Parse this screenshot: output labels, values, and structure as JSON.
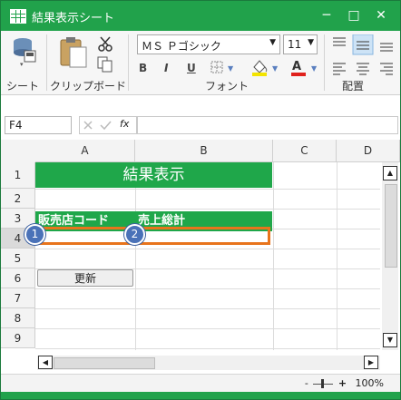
{
  "window": {
    "title": "結果表示シート",
    "minimize": "─",
    "maximize": "□",
    "close": "✕"
  },
  "ribbon": {
    "groups": {
      "sheet": "シート",
      "clipboard": "クリップボード",
      "font": "フォント",
      "align": "配置"
    },
    "font_name": "ＭＳ Ｐゴシック",
    "font_size": "11",
    "bold": "B",
    "italic": "I",
    "underline": "U"
  },
  "formula_bar": {
    "name_box": "F4",
    "fx": "fx",
    "value": ""
  },
  "columns": [
    "A",
    "B",
    "C",
    "D"
  ],
  "rows": [
    "1",
    "2",
    "3",
    "4",
    "5",
    "6",
    "7",
    "8",
    "9"
  ],
  "cells": {
    "title": "結果表示",
    "a3": "販売店コード",
    "b3": "売上総計"
  },
  "markers": [
    "1",
    "2"
  ],
  "update_button": "更新",
  "statusbar": {
    "minus": "-",
    "plus": "+",
    "zoom": "100%"
  },
  "colors": {
    "brand": "#21a24b",
    "header_cell": "#1fa74a",
    "selection": "#e8741c",
    "marker": "#4a72b8"
  }
}
